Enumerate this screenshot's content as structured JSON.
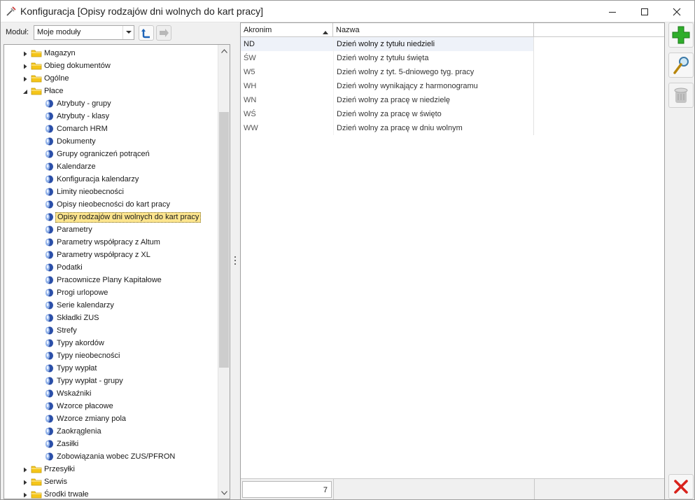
{
  "window": {
    "title": "Konfiguracja [Opisy rodzajów dni wolnych do kart pracy]"
  },
  "module_bar": {
    "label": "Moduł:",
    "selected": "Moje moduły"
  },
  "tree": {
    "items": [
      {
        "label": "Magazyn",
        "level": 0,
        "type": "folder",
        "expanded": false
      },
      {
        "label": "Obieg dokumentów",
        "level": 0,
        "type": "folder",
        "expanded": false
      },
      {
        "label": "Ogólne",
        "level": 0,
        "type": "folder",
        "expanded": false
      },
      {
        "label": "Płace",
        "level": 0,
        "type": "folder",
        "expanded": true
      },
      {
        "label": "Atrybuty - grupy",
        "level": 1,
        "type": "leaf"
      },
      {
        "label": "Atrybuty - klasy",
        "level": 1,
        "type": "leaf"
      },
      {
        "label": "Comarch HRM",
        "level": 1,
        "type": "leaf"
      },
      {
        "label": "Dokumenty",
        "level": 1,
        "type": "leaf"
      },
      {
        "label": "Grupy ograniczeń potrąceń",
        "level": 1,
        "type": "leaf"
      },
      {
        "label": "Kalendarze",
        "level": 1,
        "type": "leaf"
      },
      {
        "label": "Konfiguracja kalendarzy",
        "level": 1,
        "type": "leaf"
      },
      {
        "label": "Limity nieobecności",
        "level": 1,
        "type": "leaf"
      },
      {
        "label": "Opisy nieobecności do kart pracy",
        "level": 1,
        "type": "leaf"
      },
      {
        "label": "Opisy rodzajów dni wolnych do kart pracy",
        "level": 1,
        "type": "leaf",
        "selected": true
      },
      {
        "label": "Parametry",
        "level": 1,
        "type": "leaf"
      },
      {
        "label": "Parametry współpracy z Altum",
        "level": 1,
        "type": "leaf"
      },
      {
        "label": "Parametry współpracy z XL",
        "level": 1,
        "type": "leaf"
      },
      {
        "label": "Podatki",
        "level": 1,
        "type": "leaf"
      },
      {
        "label": "Pracownicze Plany Kapitałowe",
        "level": 1,
        "type": "leaf"
      },
      {
        "label": "Progi urlopowe",
        "level": 1,
        "type": "leaf"
      },
      {
        "label": "Serie kalendarzy",
        "level": 1,
        "type": "leaf"
      },
      {
        "label": "Składki ZUS",
        "level": 1,
        "type": "leaf"
      },
      {
        "label": "Strefy",
        "level": 1,
        "type": "leaf"
      },
      {
        "label": "Typy akordów",
        "level": 1,
        "type": "leaf"
      },
      {
        "label": "Typy nieobecności",
        "level": 1,
        "type": "leaf"
      },
      {
        "label": "Typy wypłat",
        "level": 1,
        "type": "leaf"
      },
      {
        "label": "Typy wypłat - grupy",
        "level": 1,
        "type": "leaf"
      },
      {
        "label": "Wskaźniki",
        "level": 1,
        "type": "leaf"
      },
      {
        "label": "Wzorce płacowe",
        "level": 1,
        "type": "leaf"
      },
      {
        "label": "Wzorce zmiany pola",
        "level": 1,
        "type": "leaf"
      },
      {
        "label": "Zaokrąglenia",
        "level": 1,
        "type": "leaf"
      },
      {
        "label": "Zasiłki",
        "level": 1,
        "type": "leaf"
      },
      {
        "label": "Zobowiązania wobec ZUS/PFRON",
        "level": 1,
        "type": "leaf"
      },
      {
        "label": "Przesyłki",
        "level": 0,
        "type": "folder",
        "expanded": false
      },
      {
        "label": "Serwis",
        "level": 0,
        "type": "folder",
        "expanded": false
      },
      {
        "label": "Środki trwałe",
        "level": 0,
        "type": "folder",
        "expanded": false
      }
    ]
  },
  "grid": {
    "columns": [
      "Akronim",
      "Nazwa"
    ],
    "rows": [
      [
        "ND",
        "Dzień wolny z tytułu niedzieli"
      ],
      [
        "ŚW",
        "Dzień wolny z tytułu święta"
      ],
      [
        "W5",
        "Dzień wolny z tyt. 5-dniowego tyg. pracy"
      ],
      [
        "WH",
        "Dzień wolny wynikający z harmonogramu"
      ],
      [
        "WN",
        "Dzień wolny za pracę w niedzielę"
      ],
      [
        "WŚ",
        "Dzień wolny za pracę w święto"
      ],
      [
        "WW",
        "Dzień wolny za pracę w dniu wolnym"
      ]
    ],
    "record_count": "7"
  },
  "icons": {
    "app": "configuration-icon",
    "add": "add-plus-icon",
    "edit": "magnifier-icon",
    "delete": "trash-icon",
    "close": "close-x-icon"
  },
  "colors": {
    "selection": "#fde58e",
    "add": "#2fae2b",
    "close": "#d9231c",
    "folder": "#f5c518",
    "leaf": "#2b4fa8"
  }
}
